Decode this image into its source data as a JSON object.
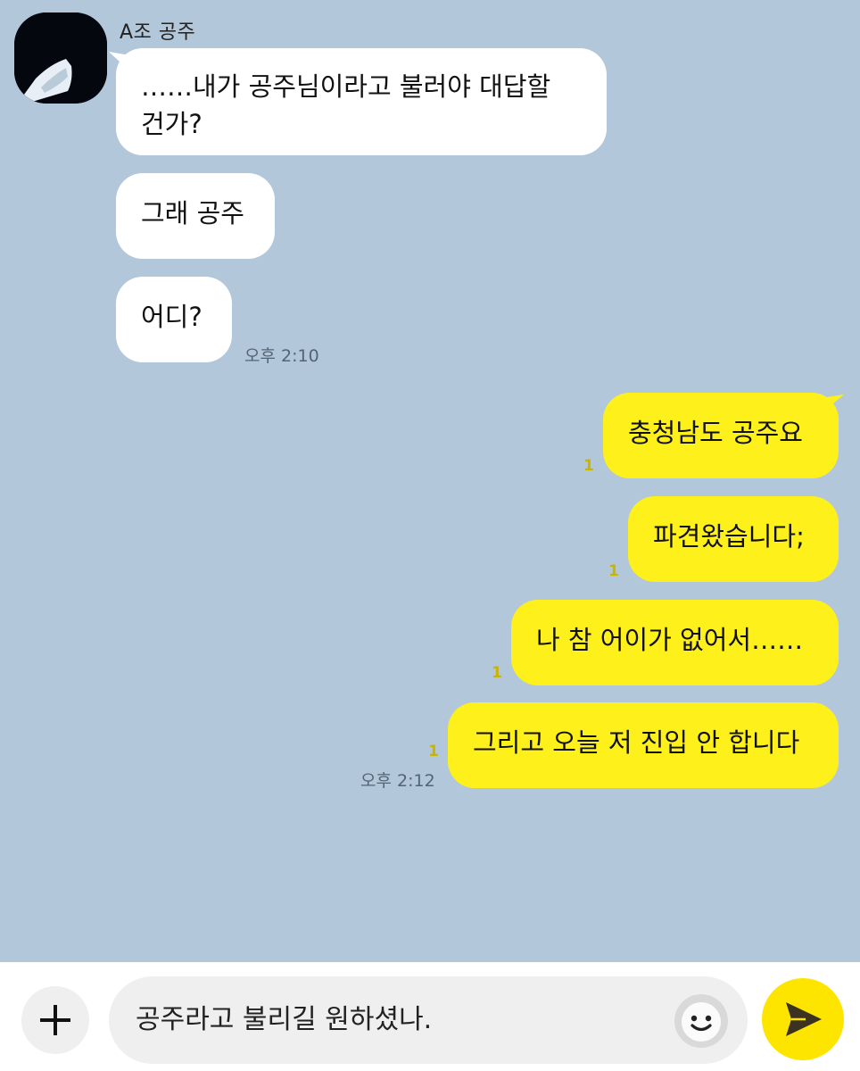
{
  "chat": {
    "sender_name": "A조 공주",
    "incoming": [
      {
        "text": "……내가 공주님이라고 불러야 대답할 건가?"
      },
      {
        "text": "그래 공주"
      },
      {
        "text": "어디?"
      }
    ],
    "incoming_time": "오후 2:10",
    "outgoing": [
      {
        "text": "충청남도 공주요",
        "unread": "1"
      },
      {
        "text": "파견왔습니다;",
        "unread": "1"
      },
      {
        "text": "나 참 어이가 없어서……",
        "unread": "1"
      },
      {
        "text": "그리고 오늘 저 진입 안 합니다",
        "unread": "1"
      }
    ],
    "outgoing_time": "오후 2:12"
  },
  "input_bar": {
    "draft_text": "공주라고 불리길 원하셨나.",
    "icons": {
      "attach": "plus-icon",
      "emoji": "smile-icon",
      "send": "send-arrow-icon"
    }
  },
  "colors": {
    "background": "#b2c7da",
    "incoming_bubble": "#ffffff",
    "outgoing_bubble": "#fef01b",
    "send_button": "#fee500",
    "unread": "#c9b400"
  }
}
